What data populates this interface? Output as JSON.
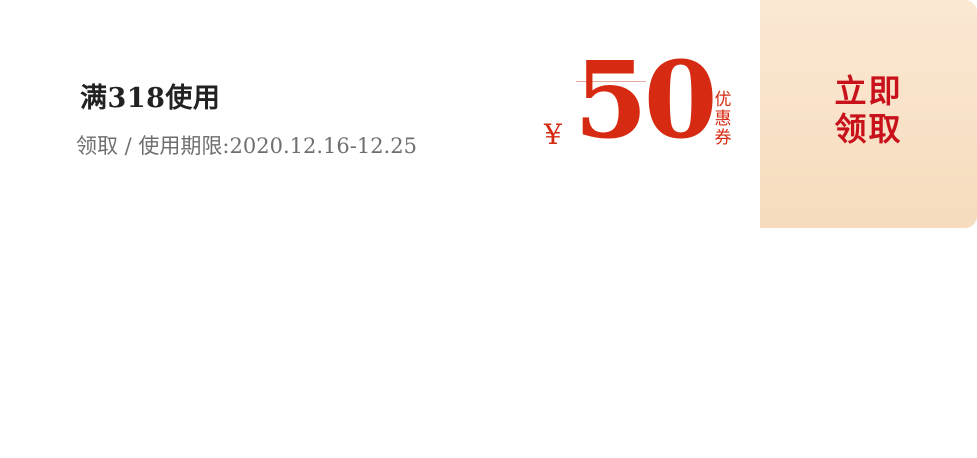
{
  "coupon": {
    "condition": "满318使用",
    "validity": "领取 / 使用期限:2020.12.16-12.25",
    "currency_symbol": "¥",
    "amount": "50",
    "coupon_word": "优惠券",
    "claim_line1": "立即",
    "claim_line2": "领取"
  },
  "colors": {
    "accent_red": "#d72a12",
    "claim_bg_top": "#fbe8d3",
    "claim_bg_bottom": "#f6dcbd",
    "claim_text": "#c8111b"
  }
}
